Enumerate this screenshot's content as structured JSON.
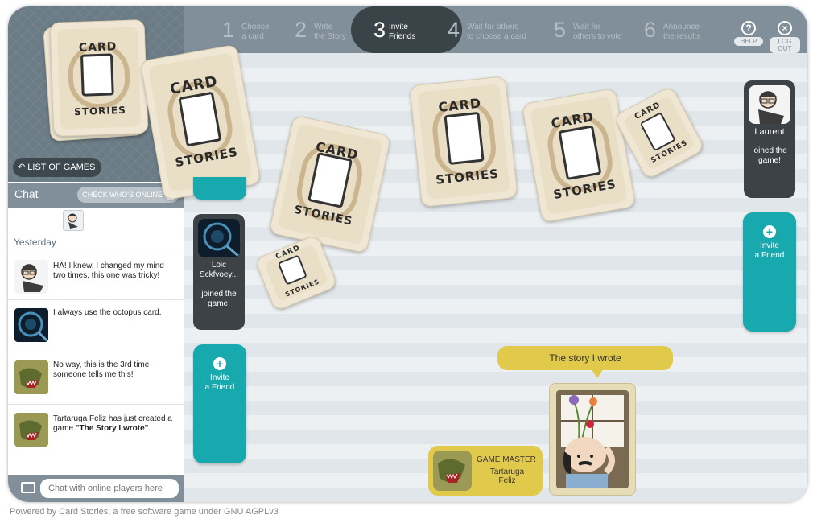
{
  "steps": [
    {
      "num": "1",
      "line1": "Choose",
      "line2": "a card"
    },
    {
      "num": "2",
      "line1": "Write",
      "line2": "the Story"
    },
    {
      "num": "3",
      "line1": "Invite",
      "line2": "Friends"
    },
    {
      "num": "4",
      "line1": "Wait for others",
      "line2": "to choose a card"
    },
    {
      "num": "5",
      "line1": "Wait for",
      "line2": "others to vote"
    },
    {
      "num": "6",
      "line1": "Announce",
      "line2": "the results"
    }
  ],
  "topbar": {
    "help_icon": "?",
    "help_label": "HELP",
    "logout_icon": "×",
    "logout_label": "LOG OUT"
  },
  "deck": {
    "list_label": "LIST OF GAMES"
  },
  "card_logo": {
    "line1": "CARD",
    "line2": "STORIES"
  },
  "chat": {
    "title": "Chat",
    "who_label": "CHECK WHO'S ONLINE",
    "day": "Yesterday",
    "messages": [
      {
        "text": "HA! I knew, I changed my mind two times, this one was tricky!"
      },
      {
        "text": "I always use the octopus card."
      },
      {
        "text": "No way, this is the 3rd time someone tells me this!"
      },
      {
        "text_pre": "Tartaruga Feliz has just created a game ",
        "text_bold": "\"The Story I wrote\""
      }
    ],
    "input_placeholder": "Chat with online players here"
  },
  "players": [
    {
      "name": "Loic Sckfvoey...",
      "status": "joined the game!"
    },
    {
      "name": "Laurent",
      "status": "joined the game!"
    }
  ],
  "invite": {
    "label_line1": "Invite",
    "label_line2": "a Friend"
  },
  "story_bubble": "The story I wrote",
  "game_master": {
    "title": "GAME MASTER",
    "name_line1": "Tartaruga",
    "name_line2": "Feliz"
  },
  "footer": "Powered by Card Stories, a free software game under GNU AGPLv3",
  "colors": {
    "teal": "#17a9ae",
    "yellow": "#e1c94b",
    "dark": "#3c4246",
    "slate": "#808f99"
  }
}
